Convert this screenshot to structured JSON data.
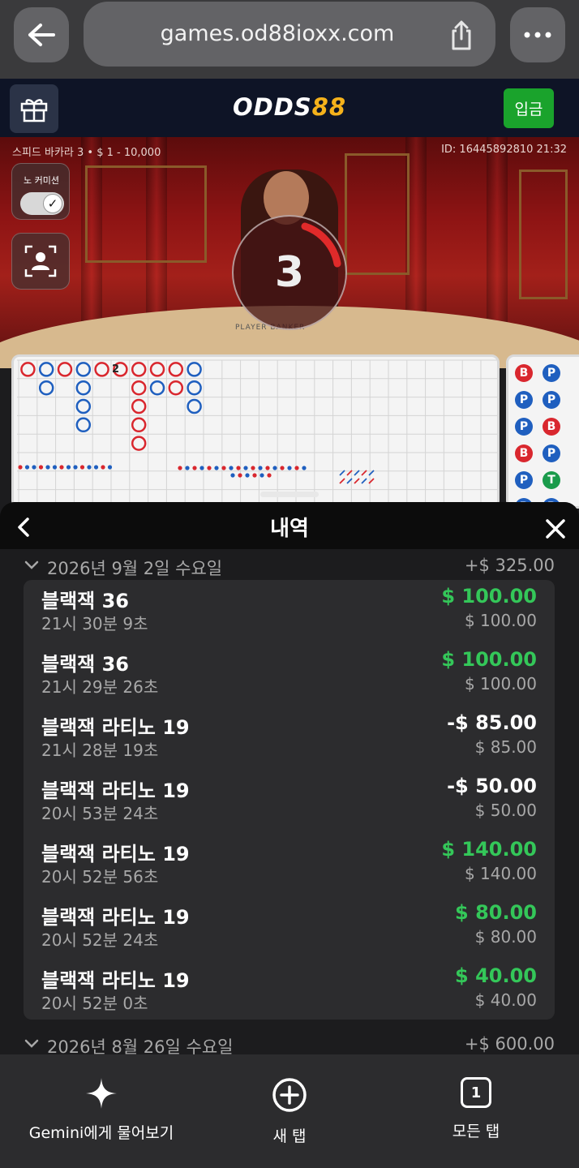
{
  "browser": {
    "url": "games.od88ioxx.com",
    "icons": {
      "back": "arrow-left-icon",
      "share": "share-icon",
      "menu": "more-horizontal-icon"
    }
  },
  "game_header": {
    "logo_part1": "ODDS",
    "logo_part2": "88",
    "deposit_label": "입금",
    "brand_color": "#f5b21b",
    "deposit_color": "#1aa32c"
  },
  "game": {
    "table_info": "스피드 바카라 3 • $ 1 - 10,000",
    "round_id": "ID: 16445892810 21:32",
    "no_commission_label": "노 커미션",
    "no_commission_on": true,
    "countdown": "3",
    "table_print": "PLAYER  BANKER",
    "road_inline_number": "2",
    "side_beads": [
      [
        "B",
        "P"
      ],
      [
        "P",
        "P"
      ],
      [
        "P",
        "B"
      ],
      [
        "B",
        "P"
      ],
      [
        "P",
        "T"
      ],
      [
        "P",
        "P"
      ]
    ],
    "colors": {
      "banker": "#d9272e",
      "player": "#1f5fbf",
      "tie": "#1a9b4b"
    }
  },
  "history": {
    "title": "내역",
    "groups": [
      {
        "date": "2026년 9월 2일 수요일",
        "total": "+$ 325.00",
        "items": [
          {
            "game": "블랙잭 36",
            "time": "21시 30분 9초",
            "result": "$ 100.00",
            "bet": "$ 100.00",
            "win": true
          },
          {
            "game": "블랙잭 36",
            "time": "21시 29분 26초",
            "result": "$ 100.00",
            "bet": "$ 100.00",
            "win": true
          },
          {
            "game": "블랙잭 라티노 19",
            "time": "21시 28분 19초",
            "result": "-$ 85.00",
            "bet": "$ 85.00",
            "win": false
          },
          {
            "game": "블랙잭 라티노 19",
            "time": "20시 53분 24초",
            "result": "-$ 50.00",
            "bet": "$ 50.00",
            "win": false
          },
          {
            "game": "블랙잭 라티노 19",
            "time": "20시 52분 56초",
            "result": "$ 140.00",
            "bet": "$ 140.00",
            "win": true
          },
          {
            "game": "블랙잭 라티노 19",
            "time": "20시 52분 24초",
            "result": "$ 80.00",
            "bet": "$ 80.00",
            "win": true
          },
          {
            "game": "블랙잭 라티노 19",
            "time": "20시 52분 0초",
            "result": "$ 40.00",
            "bet": "$ 40.00",
            "win": true
          }
        ]
      },
      {
        "date": "2026년 8월 26일 수요일",
        "total": "+$ 600.00",
        "items": []
      }
    ],
    "win_color": "#34c759"
  },
  "bottom_bar": {
    "ask_gemini": "Gemini에게 물어보기",
    "new_tab": "새 탭",
    "all_tabs": "모든 탭",
    "tab_count": "1"
  }
}
